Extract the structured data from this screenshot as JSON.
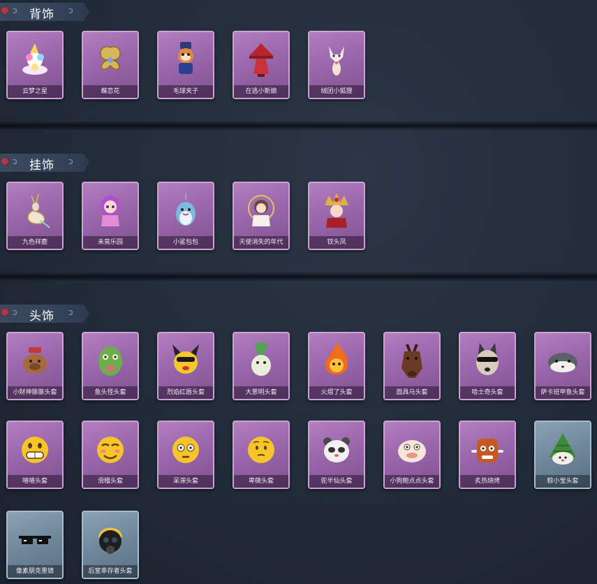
{
  "sections": [
    {
      "title": "背饰",
      "items": [
        {
          "label": "云梦之星",
          "icon": "rainbow-unicorn-icon"
        },
        {
          "label": "蝶恋花",
          "icon": "golden-butterfly-icon"
        },
        {
          "label": "毛球夹子",
          "icon": "raccoon-doll-icon"
        },
        {
          "label": "在逃小新娘",
          "icon": "red-bride-doll-icon"
        },
        {
          "label": "绒团小狐狸",
          "icon": "white-fox-icon"
        }
      ]
    },
    {
      "title": "挂饰",
      "items": [
        {
          "label": "九色祥鹿",
          "icon": "golden-deer-icon"
        },
        {
          "label": "未竟乐园",
          "icon": "purple-hair-doll-icon"
        },
        {
          "label": "小鲨包包",
          "icon": "shark-bag-icon"
        },
        {
          "label": "天使消失的年代",
          "icon": "angel-girl-icon"
        },
        {
          "label": "钗头凤",
          "icon": "phoenix-crown-icon"
        }
      ]
    },
    {
      "title": "头饰",
      "items": [
        {
          "label": "小财神豚豚头套",
          "icon": "capybara-head-icon"
        },
        {
          "label": "鱼头怪头套",
          "icon": "fish-head-icon"
        },
        {
          "label": "烈焰红唇头套",
          "icon": "yellow-creature-sunglasses-icon"
        },
        {
          "label": "大葱明头套",
          "icon": "green-onion-head-icon"
        },
        {
          "label": "火熠了头套",
          "icon": "fire-spirit-icon"
        },
        {
          "label": "面具马头套",
          "icon": "horse-mask-icon"
        },
        {
          "label": "哈士奇头套",
          "icon": "husky-sunglasses-icon"
        },
        {
          "label": "萨卡班甲鱼头套",
          "icon": "sacabambaspis-icon"
        },
        {
          "label": "嘻嘻头套",
          "icon": "grin-emoji-icon"
        },
        {
          "label": "滑稽头套",
          "icon": "smirk-emoji-icon"
        },
        {
          "label": "呆滞头套",
          "icon": "dazed-emoji-icon"
        },
        {
          "label": "卑微头套",
          "icon": "shy-emoji-icon"
        },
        {
          "label": "驼半仙头套",
          "icon": "panda-bear-head-icon"
        },
        {
          "label": "小狗鲍点点头套",
          "icon": "pug-head-icon"
        },
        {
          "label": "炙热烧烤",
          "icon": "bbq-meat-icon"
        },
        {
          "label": "粽小宝头套",
          "icon": "zongzi-head-icon"
        },
        {
          "label": "像素朋克墨镜",
          "icon": "pixel-sunglasses-icon"
        },
        {
          "label": "后室幸存者头套",
          "icon": "gas-mask-helmet-icon"
        }
      ]
    }
  ],
  "colors": {
    "background": "#222b39",
    "card_purple": "#9a67ab",
    "card_blue": "#6f879b",
    "header": "#3c4a5e",
    "pin": "#b0364a"
  }
}
